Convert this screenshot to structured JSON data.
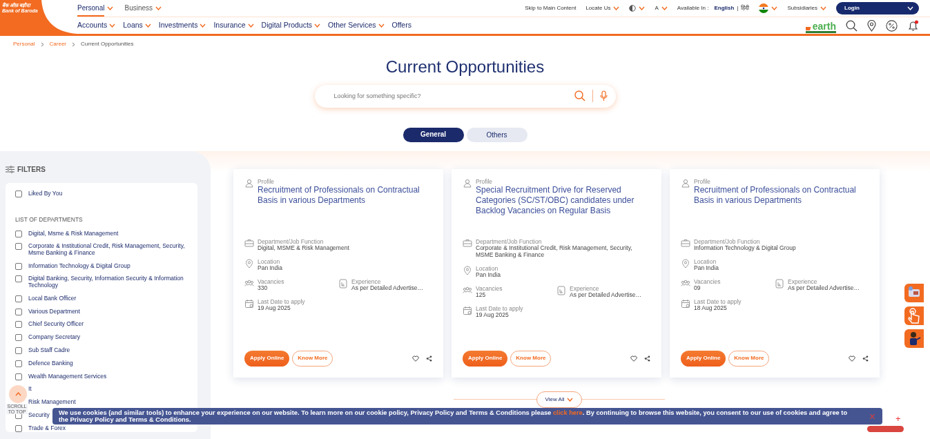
{
  "header": {
    "logo": {
      "hindi": "बैंक ऑफ़ बड़ौदा",
      "english": "Bank of Baroda"
    },
    "segments": [
      {
        "label": "Personal",
        "selected": true
      },
      {
        "label": "Business",
        "selected": false
      }
    ],
    "utility": {
      "skip": "Skip to Main Content",
      "locate": "Locate Us",
      "font": "A",
      "available_label": "Available In :",
      "languages": [
        {
          "label": "English",
          "selected": true
        },
        {
          "label": "हिंदी",
          "selected": false
        }
      ],
      "separator": "|",
      "subsidiaries": "Subsidiaries",
      "login": "Login"
    },
    "nav": [
      {
        "label": "Accounts",
        "dropdown": true
      },
      {
        "label": "Loans",
        "dropdown": true
      },
      {
        "label": "Investments",
        "dropdown": true
      },
      {
        "label": "Insurance",
        "dropdown": true
      },
      {
        "label": "Digital Products",
        "dropdown": true
      },
      {
        "label": "Other Services",
        "dropdown": true
      },
      {
        "label": "Offers",
        "dropdown": false
      }
    ],
    "earth_logo": "earth",
    "notifications": true
  },
  "breadcrumb": [
    {
      "label": "Personal",
      "link": true
    },
    {
      "label": "Career",
      "link": true
    },
    {
      "label": "Current Opportunities",
      "link": false
    }
  ],
  "title": "Current Opportunities",
  "search": {
    "placeholder": "Looking for something specific?"
  },
  "tabs": [
    {
      "label": "General",
      "selected": true
    },
    {
      "label": "Others",
      "selected": false
    }
  ],
  "filters": {
    "title": "FILTERS",
    "liked": {
      "label": "Liked By You",
      "checked": false
    },
    "section": "LIST OF DEPARTMENTS",
    "departments": [
      {
        "label": "Digital, Msme & Risk Management",
        "checked": false
      },
      {
        "label": "Corporate & Institutional Credit, Risk Management, Security, Msme Banking & Finance",
        "checked": false
      },
      {
        "label": "Information Technology & Digital Group",
        "checked": false
      },
      {
        "label": "Digital Banking, Security, Information Security & Information Technology",
        "checked": false
      },
      {
        "label": "Local Bank Officer",
        "checked": false
      },
      {
        "label": "Various Department",
        "checked": false
      },
      {
        "label": "Chief Security Officer",
        "checked": false
      },
      {
        "label": "Company Secretary",
        "checked": false
      },
      {
        "label": "Sub Staff Cadre",
        "checked": false
      },
      {
        "label": "Defence Banking",
        "checked": false
      },
      {
        "label": "Wealth Management Services",
        "checked": false
      },
      {
        "label": "It"
      },
      {
        "label": "Risk Management"
      },
      {
        "label": "Security",
        "checked": false
      },
      {
        "label": "Trade & Forex",
        "checked": false
      }
    ]
  },
  "jobs": [
    {
      "profile_label": "Profile",
      "title": "Recruitment of Professionals on Contractual Basis in various Departments",
      "rows": [
        [
          {
            "kind": "department",
            "label": "Department/Job Function",
            "value": "Digital, MSME & Risk Management"
          }
        ],
        [
          {
            "kind": "location",
            "label": "Location",
            "value": "Pan India"
          }
        ],
        [
          {
            "kind": "vacancies",
            "label": "Vacancies",
            "value": "330"
          },
          {
            "kind": "experience",
            "label": "Experience",
            "value": "As per Detailed Advertise…"
          }
        ],
        [
          {
            "kind": "date",
            "label": "Last Date to apply",
            "value": "19 Aug 2025"
          }
        ]
      ],
      "apply": "Apply Online",
      "know_more": "Know More",
      "liked": false
    },
    {
      "profile_label": "Profile",
      "title": "Special Recruitment Drive for Reserved Categories (SC/ST/OBC) candidates under Backlog Vacancies on Regular Basis",
      "rows": [
        [
          {
            "kind": "department",
            "label": "Department/Job Function",
            "value": "Corporate & Institutional Credit, Risk Management, Security, MSME Banking & Finance"
          }
        ],
        [
          {
            "kind": "location",
            "label": "Location",
            "value": "Pan India"
          }
        ],
        [
          {
            "kind": "vacancies",
            "label": "Vacancies",
            "value": "125"
          },
          {
            "kind": "experience",
            "label": "Experience",
            "value": "As per Detailed Advertise…"
          }
        ],
        [
          {
            "kind": "date",
            "label": "Last Date to apply",
            "value": "19 Aug 2025"
          }
        ]
      ],
      "apply": "Apply Online",
      "know_more": "Know More",
      "liked": false
    },
    {
      "profile_label": "Profile",
      "title": "Recruitment of Professionals on Contractual Basis in various Departments",
      "rows": [
        [
          {
            "kind": "department",
            "label": "Department/Job Function",
            "value": "Information Technology & Digital Group"
          }
        ],
        [
          {
            "kind": "location",
            "label": "Location",
            "value": "Pan India"
          }
        ],
        [
          {
            "kind": "vacancies",
            "label": "Vacancies",
            "value": "09"
          },
          {
            "kind": "experience",
            "label": "Experience",
            "value": "As per Detailed Advertise…"
          }
        ],
        [
          {
            "kind": "date",
            "label": "Last Date to apply",
            "value": "18 Aug 2025"
          }
        ]
      ],
      "apply": "Apply Online",
      "know_more": "Know More",
      "liked": false
    }
  ],
  "view_all": "View All",
  "scroll_top": "SCROLL TO TOP",
  "chat_plus": "+",
  "cookie": {
    "before": "We use cookies (and similar tools) to enhance your experience on our website. To learn more on our cookie policy, Privacy Policy and Terms & Conditions please ",
    "link": "click here",
    "after": ". By continuing to browse this website, you consent to our use of cookies and agree to the Privacy Policy and Terms & Conditions.",
    "close": "×"
  }
}
